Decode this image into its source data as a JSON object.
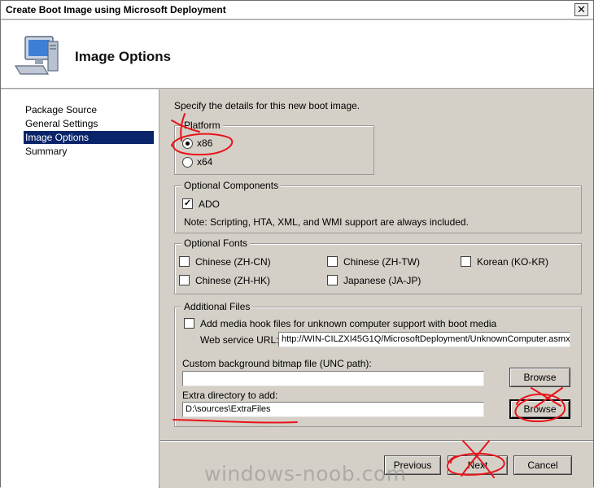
{
  "window": {
    "title": "Create Boot Image using Microsoft Deployment",
    "close_glyph": "✕"
  },
  "header": {
    "title": "Image Options",
    "icon": "computer-icon"
  },
  "nav": {
    "items": [
      {
        "label": "Package Source",
        "selected": false
      },
      {
        "label": "General Settings",
        "selected": false
      },
      {
        "label": "Image Options",
        "selected": true
      },
      {
        "label": "Summary",
        "selected": false
      }
    ]
  },
  "main": {
    "intro": "Specify the details for this new boot image.",
    "platform": {
      "legend": "Platform",
      "options": [
        {
          "label": "x86",
          "selected": true
        },
        {
          "label": "x64",
          "selected": false
        }
      ]
    },
    "optional_components": {
      "legend": "Optional Components",
      "ado_label": "ADO",
      "ado_checked": true,
      "note": "Note: Scripting, HTA, XML, and WMI support are always included."
    },
    "optional_fonts": {
      "legend": "Optional Fonts",
      "fonts": [
        {
          "label": "Chinese (ZH-CN)",
          "checked": false
        },
        {
          "label": "Chinese (ZH-TW)",
          "checked": false
        },
        {
          "label": "Korean (KO-KR)",
          "checked": false
        },
        {
          "label": "Chinese (ZH-HK)",
          "checked": false
        },
        {
          "label": "Japanese (JA-JP)",
          "checked": false
        }
      ]
    },
    "additional_files": {
      "legend": "Additional Files",
      "media_hook_label": "Add media hook files for unknown computer support with boot media",
      "media_hook_checked": false,
      "web_service_label": "Web service URL:",
      "web_service_url": "http://WIN-CILZXI45G1Q/MicrosoftDeployment/UnknownComputer.asmx",
      "background_label": "Custom background bitmap file (UNC path):",
      "background_value": "",
      "browse_label": "Browse",
      "extra_dir_label": "Extra directory to add:",
      "extra_dir_value": "D:\\sources\\ExtraFiles",
      "browse2_label": "Browse"
    }
  },
  "buttons": {
    "previous": "Previous",
    "next": "Next",
    "cancel": "Cancel"
  },
  "watermark": "windows-noob.com",
  "colors": {
    "selection": "#0a246a",
    "ink": "#e8141b",
    "dialog_face": "#d4d0c8"
  }
}
